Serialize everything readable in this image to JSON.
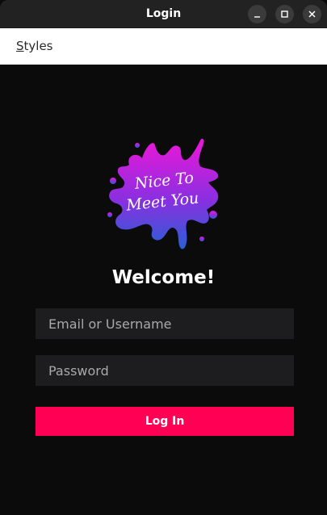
{
  "window": {
    "title": "Login"
  },
  "menubar": {
    "styles_label": "Styles"
  },
  "logo": {
    "line1": "Nice To",
    "line2": "Meet You"
  },
  "main": {
    "heading": "Welcome!",
    "email_placeholder": "Email or Username",
    "email_value": "",
    "password_placeholder": "Password",
    "password_value": "",
    "login_label": "Log In"
  },
  "colors": {
    "accent": "#ff0055",
    "background": "#0b0b0b",
    "field_bg": "#1d1d1f",
    "titlebar": "#222222",
    "splash_top": "#e91ad6",
    "splash_bottom": "#2f5ad8"
  },
  "icons": {
    "minimize": "minimize-icon",
    "maximize": "maximize-icon",
    "close": "close-icon",
    "logo": "paint-splash-logo"
  }
}
